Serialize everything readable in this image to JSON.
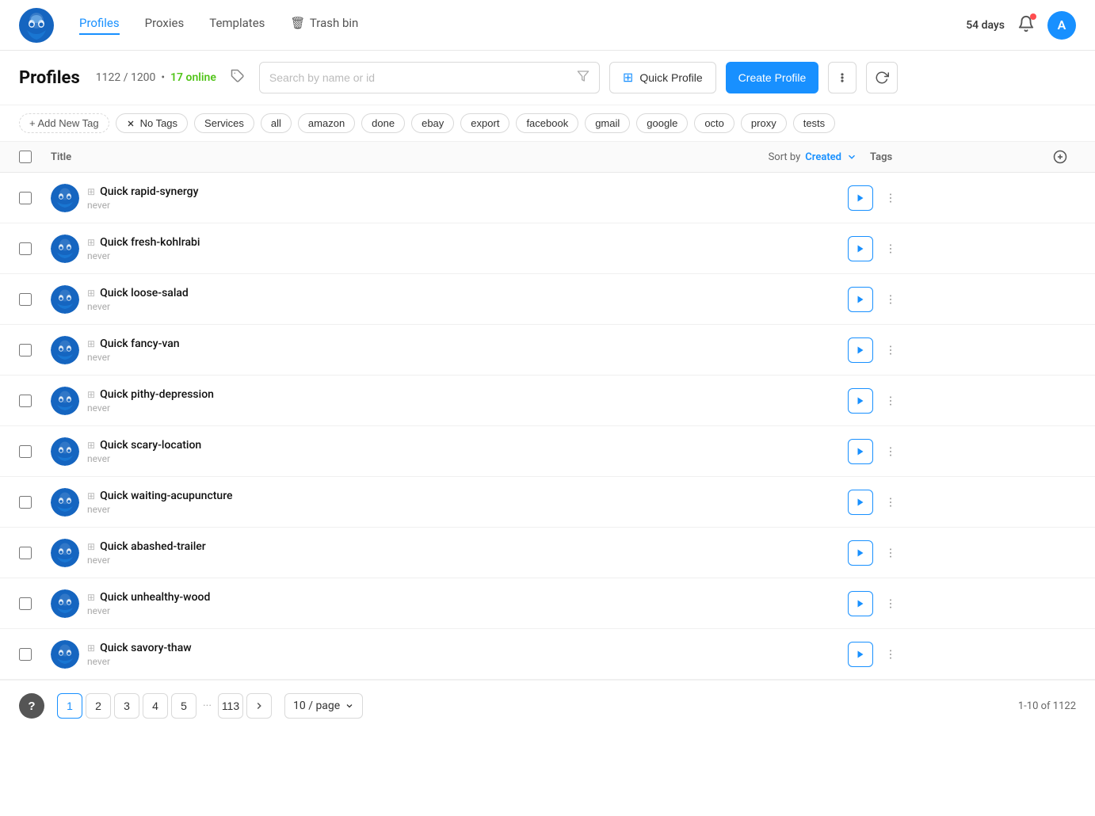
{
  "app": {
    "logo_alt": "Octo Browser Logo"
  },
  "header": {
    "nav": [
      {
        "id": "profiles",
        "label": "Profiles",
        "active": true
      },
      {
        "id": "proxies",
        "label": "Proxies",
        "active": false
      },
      {
        "id": "templates",
        "label": "Templates",
        "active": false
      },
      {
        "id": "trash",
        "label": "Trash bin",
        "active": false
      }
    ],
    "days": "54 days",
    "avatar_initial": "A"
  },
  "sub_header": {
    "title": "Profiles",
    "count": "1122 / 1200",
    "online_label": "17 online",
    "search_placeholder": "Search by name or id",
    "quick_profile_label": "Quick Profile",
    "create_profile_label": "Create Profile"
  },
  "tags_bar": {
    "add_label": "+ Add New Tag",
    "no_tags_label": "No Tags",
    "tags": [
      "Services",
      "all",
      "amazon",
      "done",
      "ebay",
      "export",
      "facebook",
      "gmail",
      "google",
      "octo",
      "proxy",
      "tests"
    ]
  },
  "table": {
    "col_title": "Title",
    "sort_label": "Sort by",
    "sort_field": "Created",
    "col_tags": "Tags",
    "rows": [
      {
        "id": 1,
        "name": "Quick rapid-synergy",
        "sub": "never"
      },
      {
        "id": 2,
        "name": "Quick fresh-kohlrabi",
        "sub": "never"
      },
      {
        "id": 3,
        "name": "Quick loose-salad",
        "sub": "never"
      },
      {
        "id": 4,
        "name": "Quick fancy-van",
        "sub": "never"
      },
      {
        "id": 5,
        "name": "Quick pithy-depression",
        "sub": "never"
      },
      {
        "id": 6,
        "name": "Quick scary-location",
        "sub": "never"
      },
      {
        "id": 7,
        "name": "Quick waiting-acupuncture",
        "sub": "never"
      },
      {
        "id": 8,
        "name": "Quick abashed-trailer",
        "sub": "never"
      },
      {
        "id": 9,
        "name": "Quick unhealthy-wood",
        "sub": "never"
      },
      {
        "id": 10,
        "name": "Quick savory-thaw",
        "sub": "never"
      }
    ]
  },
  "pagination": {
    "pages": [
      "1",
      "2",
      "3",
      "4",
      "5"
    ],
    "ellipsis": "···",
    "last_page": "113",
    "page_size": "10 / page",
    "info": "1-10 of 1122",
    "current_page": "1"
  }
}
